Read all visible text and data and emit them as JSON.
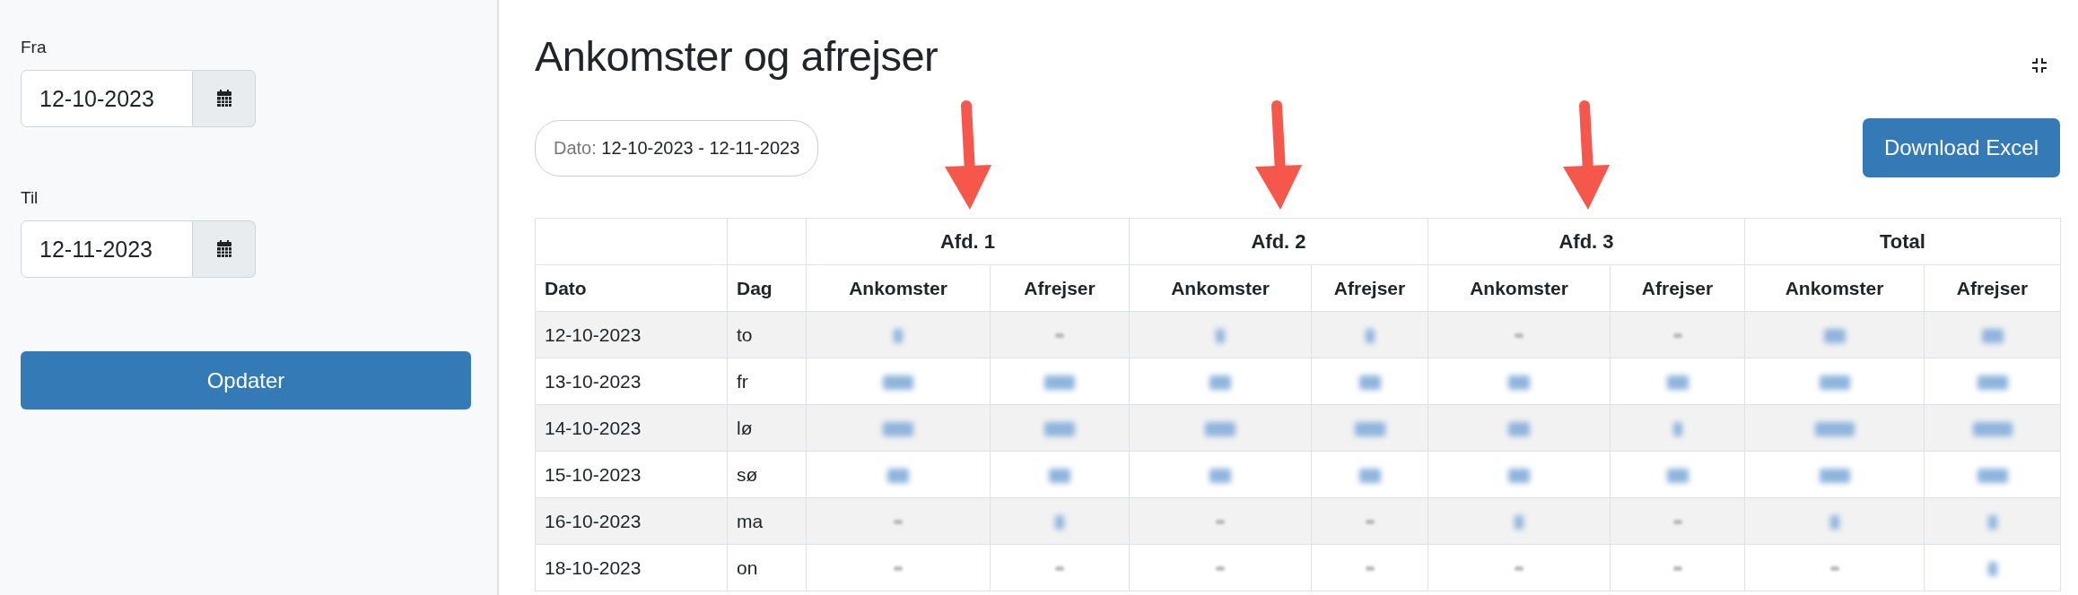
{
  "sidebar": {
    "fields": [
      {
        "label": "Fra",
        "value": "12-10-2023"
      },
      {
        "label": "Til",
        "value": "12-11-2023"
      }
    ],
    "button": "Opdater"
  },
  "title": "Ankomster og afrejser",
  "date_filter": {
    "label": "Dato:",
    "value": "12-10-2023 - 12-11-2023"
  },
  "download_button": "Download Excel",
  "table": {
    "groups": [
      {
        "label": "Afd. 1",
        "arrow": true
      },
      {
        "label": "Afd. 2",
        "arrow": true
      },
      {
        "label": "Afd. 3",
        "arrow": true
      },
      {
        "label": "Total"
      }
    ],
    "columns": [
      "Dato",
      "Dag"
    ],
    "subcolumns": [
      "Ankomster",
      "Afrejser",
      "Ankomster",
      "Afrejser",
      "Ankomster",
      "Afrejser",
      "Ankomster",
      "Afrejser"
    ],
    "rows": [
      {
        "date": "12-10-2023",
        "day": "to",
        "cells": [
          {
            "kind": "one"
          },
          {
            "kind": "dash"
          },
          {
            "kind": "one"
          },
          {
            "kind": "one"
          },
          {
            "kind": "dash"
          },
          {
            "kind": "dash"
          },
          {
            "kind": "two"
          },
          {
            "kind": "two"
          }
        ]
      },
      {
        "date": "13-10-2023",
        "day": "fr",
        "cells": [
          {
            "kind": "three"
          },
          {
            "kind": "three"
          },
          {
            "kind": "two"
          },
          {
            "kind": "two"
          },
          {
            "kind": "two"
          },
          {
            "kind": "two"
          },
          {
            "kind": "three"
          },
          {
            "kind": "three"
          }
        ]
      },
      {
        "date": "14-10-2023",
        "day": "lø",
        "cells": [
          {
            "kind": "three"
          },
          {
            "kind": "three"
          },
          {
            "kind": "three"
          },
          {
            "kind": "three"
          },
          {
            "kind": "two"
          },
          {
            "kind": "one"
          },
          {
            "kind": "four"
          },
          {
            "kind": "four"
          }
        ]
      },
      {
        "date": "15-10-2023",
        "day": "sø",
        "cells": [
          {
            "kind": "two"
          },
          {
            "kind": "two"
          },
          {
            "kind": "two"
          },
          {
            "kind": "two"
          },
          {
            "kind": "two"
          },
          {
            "kind": "two"
          },
          {
            "kind": "three"
          },
          {
            "kind": "three"
          }
        ]
      },
      {
        "date": "16-10-2023",
        "day": "ma",
        "cells": [
          {
            "kind": "dash"
          },
          {
            "kind": "one"
          },
          {
            "kind": "dash"
          },
          {
            "kind": "dash"
          },
          {
            "kind": "one"
          },
          {
            "kind": "dash"
          },
          {
            "kind": "one"
          },
          {
            "kind": "one"
          }
        ]
      },
      {
        "date": "18-10-2023",
        "day": "on",
        "cells": [
          {
            "kind": "dash"
          },
          {
            "kind": "dash"
          },
          {
            "kind": "dash"
          },
          {
            "kind": "dash"
          },
          {
            "kind": "dash"
          },
          {
            "kind": "dash"
          },
          {
            "kind": "dash"
          },
          {
            "kind": "one"
          }
        ]
      }
    ]
  }
}
